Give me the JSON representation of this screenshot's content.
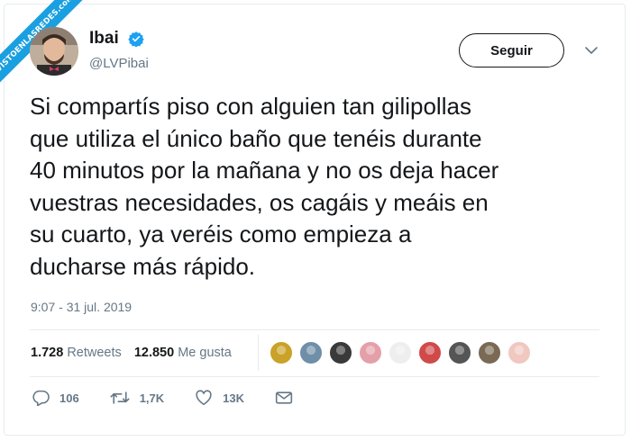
{
  "watermark": {
    "text": "VISTOENLASREDES.com"
  },
  "author": {
    "name": "Ibai",
    "handle": "@LVPibai",
    "verified": true,
    "avatar_icon": "profile-photo"
  },
  "follow_button": {
    "label": "Seguir"
  },
  "tweet": {
    "lines": [
      "Si compartís piso con alguien tan gilipollas",
      "que utiliza el único baño que tenéis durante",
      "40 minutos por la mañana y no os deja hacer",
      "vuestras necesidades, os cagáis y meáis en",
      "su cuarto, ya veréis como empieza a",
      "ducharse más rápido."
    ],
    "timestamp": "9:07 - 31 jul. 2019"
  },
  "stats": {
    "retweets_count": "1.728",
    "retweets_label": "Retweets",
    "likes_count": "12.850",
    "likes_label": "Me gusta"
  },
  "likers": [
    "#c9a227",
    "#6f8fa8",
    "#3a3a3a",
    "#e4a0a8",
    "#eeeeee",
    "#d04a4a",
    "#555555",
    "#7a6a55",
    "#f0c8c0"
  ],
  "actions": {
    "replies": "106",
    "retweets": "1,7K",
    "likes": "13K"
  },
  "colors": {
    "accent": "#1da1f2",
    "text": "#14171a",
    "muted": "#657786"
  }
}
